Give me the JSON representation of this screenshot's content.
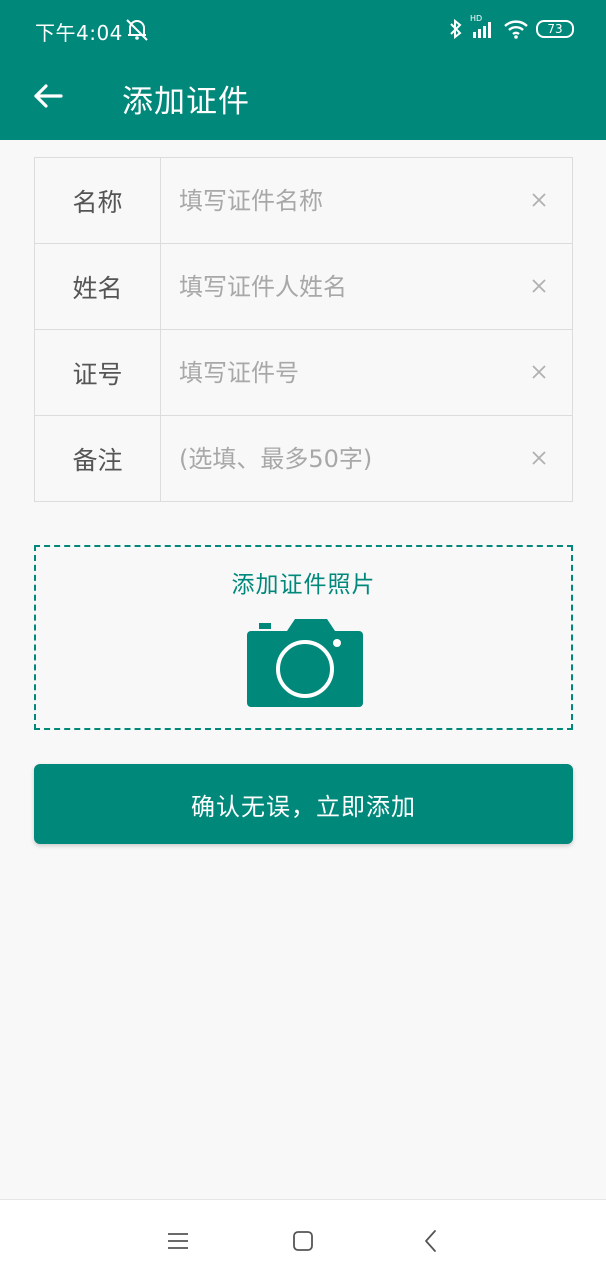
{
  "status_bar": {
    "time": "下午4:04",
    "battery": "73",
    "network_badge": "HD",
    "icons": [
      "alarm-off-icon",
      "bluetooth-icon",
      "signal-icon",
      "wifi-icon",
      "battery-icon"
    ]
  },
  "app_bar": {
    "title": "添加证件",
    "back_icon": "arrow-left-icon"
  },
  "form": {
    "rows": [
      {
        "label": "名称",
        "value": "",
        "placeholder": "填写证件名称"
      },
      {
        "label": "姓名",
        "value": "",
        "placeholder": "填写证件人姓名"
      },
      {
        "label": "证号",
        "value": "",
        "placeholder": "填写证件号"
      },
      {
        "label": "备注",
        "value": "",
        "placeholder": "(选填、最多50字)"
      }
    ],
    "clear_icon": "close-icon"
  },
  "photo": {
    "label": "添加证件照片",
    "icon": "camera-icon"
  },
  "confirm_button": {
    "label": "确认无误，立即添加"
  },
  "nav_bar": {
    "icons": [
      "menu-icon",
      "home-icon",
      "back-icon"
    ]
  },
  "colors": {
    "primary": "#00897b",
    "background": "#f8f8f8",
    "border": "#dcdcdc",
    "placeholder": "#a8a8a8",
    "label": "#555555"
  }
}
